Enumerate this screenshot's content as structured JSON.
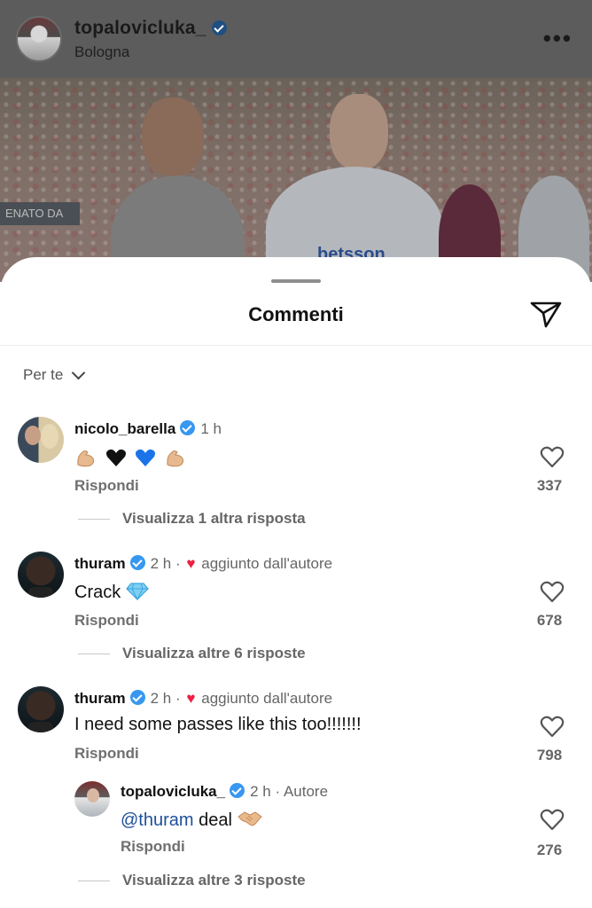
{
  "post": {
    "username": "topalovicluka_",
    "location": "Bologna",
    "banner_text": "ENATO DA",
    "jersey_text": "betsson"
  },
  "sheet": {
    "title": "Commenti",
    "sort_label": "Per te"
  },
  "comments": [
    {
      "username": "nicolo_barella",
      "time": "1 h",
      "text_emojis": [
        "flexed-biceps",
        "black-heart",
        "blue-heart",
        "flexed-biceps"
      ],
      "reply_label": "Rispondi",
      "likes": "337",
      "more_replies": "Visualizza 1 altra risposta"
    },
    {
      "username": "thuram",
      "time": "2 h",
      "separator": "·",
      "badge": "aggiunto dall'autore",
      "text": "Crack",
      "text_emoji": "gem",
      "reply_label": "Rispondi",
      "likes": "678",
      "more_replies": "Visualizza altre 6 risposte"
    },
    {
      "username": "thuram",
      "time": "2 h",
      "separator": "·",
      "badge": "aggiunto dall'autore",
      "text": "I need some passes like this too!!!!!!!",
      "reply_label": "Rispondi",
      "likes": "798",
      "reply": {
        "username": "topalovicluka_",
        "time": "2 h",
        "separator": "·",
        "author_label": "Autore",
        "mention": "@thuram",
        "text": "deal",
        "text_emoji": "handshake",
        "reply_label": "Rispondi",
        "likes": "276"
      },
      "more_replies": "Visualizza altre 3 risposte"
    }
  ],
  "colors": {
    "verified": "#3897f0",
    "mention": "#1e4f9c",
    "heart_red": "#ed1f43"
  }
}
